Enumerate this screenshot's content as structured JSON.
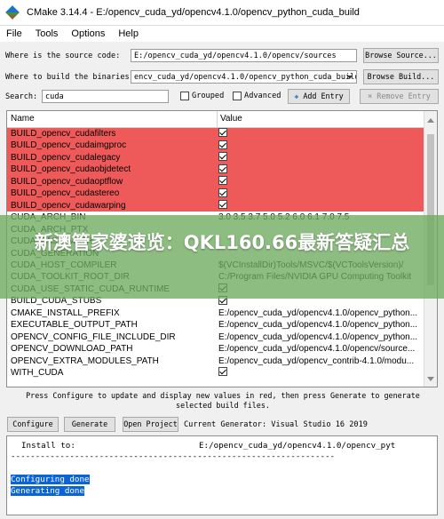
{
  "window": {
    "title": "CMake 3.14.4 - E:/opencv_cuda_yd/opencv4.1.0/opencv_python_cuda_build"
  },
  "menu": [
    "File",
    "Tools",
    "Options",
    "Help"
  ],
  "source": {
    "label": "Where is the source code:",
    "value": "E:/opencv_cuda_yd/opencv4.1.0/opencv/sources",
    "browse": "Browse Source..."
  },
  "build": {
    "label": "Where to build the binaries:",
    "value": "encv_cuda_yd/opencv4.1.0/opencv_python_cuda_build",
    "browse": "Browse Build..."
  },
  "search": {
    "label": "Search:",
    "value": "cuda",
    "grouped": "Grouped",
    "advanced": "Advanced",
    "add_entry": "Add Entry",
    "remove_entry": "Remove Entry"
  },
  "table": {
    "headers": {
      "name": "Name",
      "value": "Value"
    },
    "rows": [
      {
        "name": "BUILD_opencv_cudafilters",
        "value": "",
        "check": true,
        "red": true
      },
      {
        "name": "BUILD_opencv_cudaimgproc",
        "value": "",
        "check": true,
        "red": true
      },
      {
        "name": "BUILD_opencv_cudalegacy",
        "value": "",
        "check": true,
        "red": true
      },
      {
        "name": "BUILD_opencv_cudaobjdetect",
        "value": "",
        "check": true,
        "red": true
      },
      {
        "name": "BUILD_opencv_cudaoptflow",
        "value": "",
        "check": true,
        "red": true
      },
      {
        "name": "BUILD_opencv_cudastereo",
        "value": "",
        "check": true,
        "red": true
      },
      {
        "name": "BUILD_opencv_cudawarping",
        "value": "",
        "check": true,
        "red": true
      },
      {
        "name": "CUDA_ARCH_BIN",
        "value": "3.0 3.5 3.7 5.0 5.2 6.0 6.1 7.0 7.5",
        "check": false,
        "red": false
      },
      {
        "name": "CUDA_ARCH_PTX",
        "value": "",
        "check": false,
        "red": false
      },
      {
        "name": "CUDA_FAST_MATH",
        "value": "",
        "check": false,
        "red": false
      },
      {
        "name": "CUDA_GENERATION",
        "value": "",
        "check": false,
        "red": false
      },
      {
        "name": "CUDA_HOST_COMPILER",
        "value": "$(VCInstallDir)Tools/MSVC/$(VCToolsVersion)/",
        "check": false,
        "red": false
      },
      {
        "name": "CUDA_TOOLKIT_ROOT_DIR",
        "value": "C:/Program Files/NVIDIA GPU Computing Toolkit",
        "check": false,
        "red": false
      },
      {
        "name": "CUDA_USE_STATIC_CUDA_RUNTIME",
        "value": "",
        "check": true,
        "red": false
      },
      {
        "name": "BUILD_CUDA_STUBS",
        "value": "",
        "check": true,
        "red": false
      },
      {
        "name": "CMAKE_INSTALL_PREFIX",
        "value": "E:/opencv_cuda_yd/opencv4.1.0/opencv_python...",
        "check": false,
        "red": false
      },
      {
        "name": "EXECUTABLE_OUTPUT_PATH",
        "value": "E:/opencv_cuda_yd/opencv4.1.0/opencv_python...",
        "check": false,
        "red": false
      },
      {
        "name": "OPENCV_CONFIG_FILE_INCLUDE_DIR",
        "value": "E:/opencv_cuda_yd/opencv4.1.0/opencv_python...",
        "check": false,
        "red": false
      },
      {
        "name": "OPENCV_DOWNLOAD_PATH",
        "value": "E:/opencv_cuda_yd/opencv4.1.0/opencv/source...",
        "check": false,
        "red": false
      },
      {
        "name": "OPENCV_EXTRA_MODULES_PATH",
        "value": "E:/opencv_cuda_yd/opencv_contrib-4.1.0/modu...",
        "check": false,
        "red": false
      },
      {
        "name": "WITH_CUDA",
        "value": "",
        "check": true,
        "red": false
      }
    ]
  },
  "overlay": {
    "text": "新澳管家婆速览：QKL160.66最新答疑汇总"
  },
  "hint": "Press Configure to update and display new values in red, then press Generate to generate selected build files.",
  "actions": {
    "configure": "Configure",
    "generate": "Generate",
    "open_project": "Open Project",
    "current_generator": "Current Generator: Visual Studio 16 2019"
  },
  "output": {
    "install_label": "Install to:",
    "install_path": "E:/opencv_cuda_yd/opencv4.1.0/opencv_pyt",
    "separator": "------------------------------------------------------------------",
    "configuring_done": "Configuring done",
    "generating_done": "Generating done"
  }
}
